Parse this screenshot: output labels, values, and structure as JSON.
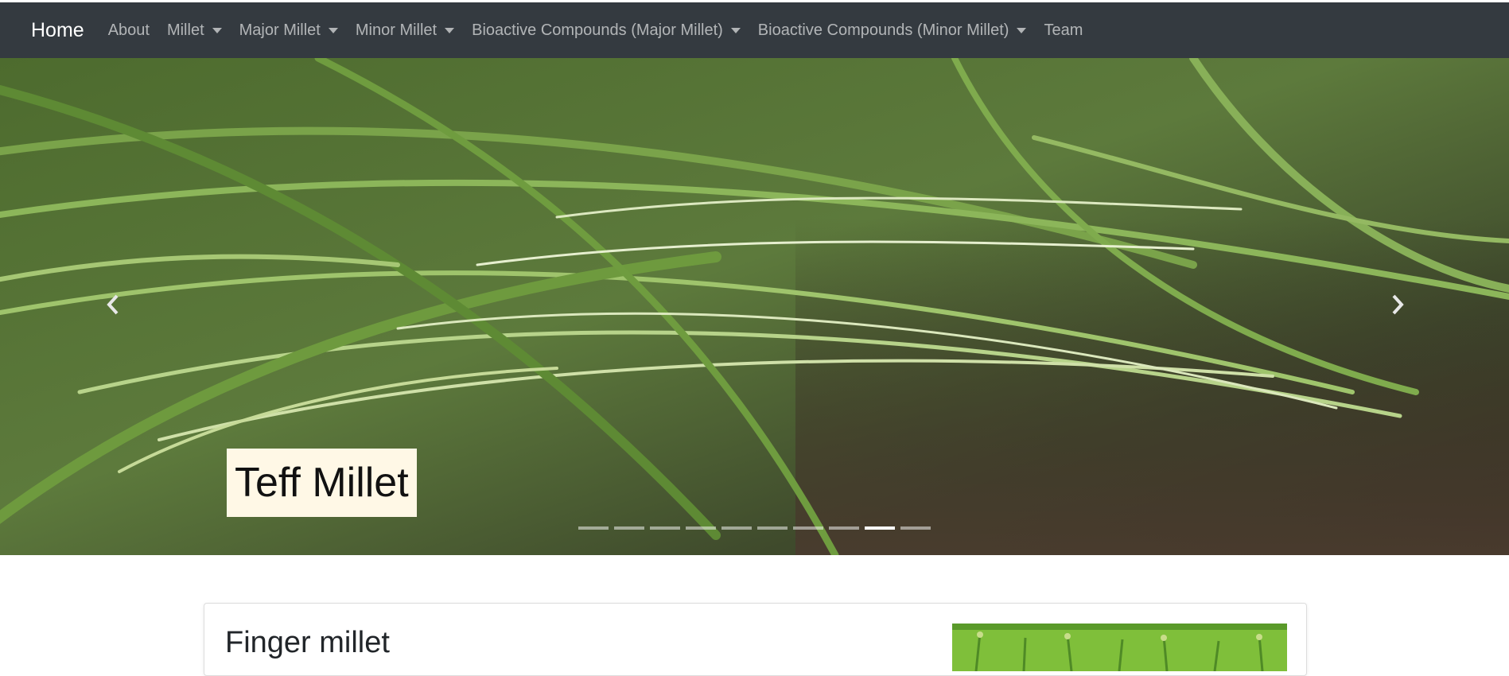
{
  "navbar": {
    "brand": "Home",
    "items": [
      {
        "label": "About",
        "dropdown": false
      },
      {
        "label": "Millet",
        "dropdown": true
      },
      {
        "label": "Major Millet",
        "dropdown": true
      },
      {
        "label": "Minor Millet",
        "dropdown": true
      },
      {
        "label": "Bioactive Compounds (Major Millet)",
        "dropdown": true
      },
      {
        "label": "Bioactive Compounds (Minor Millet)",
        "dropdown": true
      },
      {
        "label": "Team",
        "dropdown": false
      }
    ]
  },
  "carousel": {
    "caption": "Teff Millet",
    "slide_count": 10,
    "active_index": 8,
    "icons": {
      "prev": "chevron-left-icon",
      "next": "chevron-right-icon"
    }
  },
  "card": {
    "title": "Finger millet"
  },
  "colors": {
    "navbar_bg": "#343a40",
    "caption_bg": "#fff8e6"
  }
}
